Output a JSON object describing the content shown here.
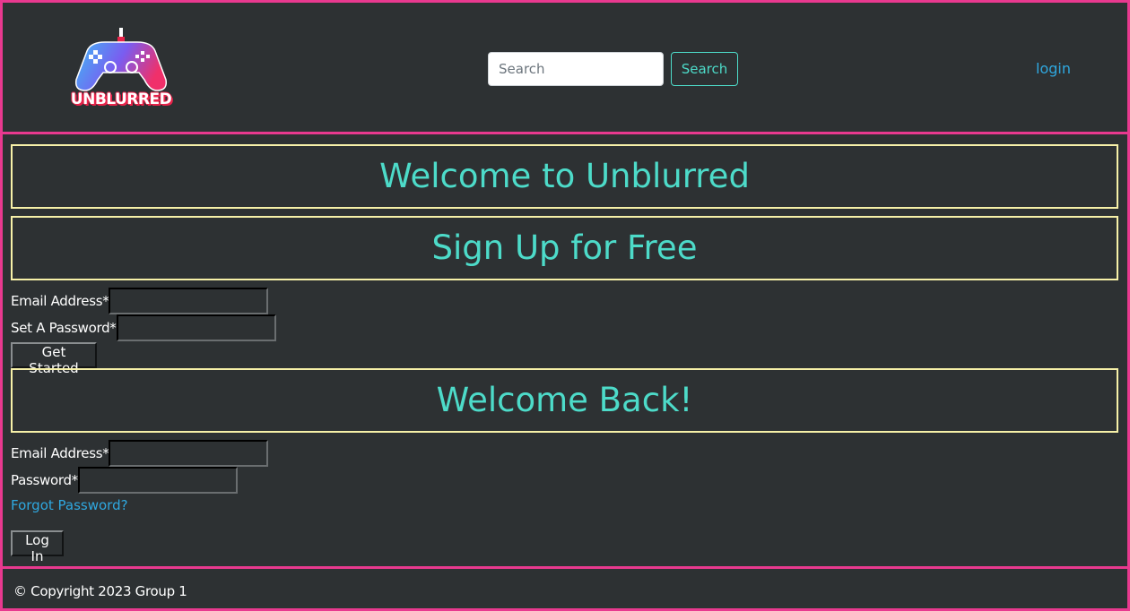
{
  "header": {
    "logo_text": "UNBLURRED",
    "search": {
      "placeholder": "Search",
      "value": "",
      "button_label": "Search"
    },
    "login_label": "login"
  },
  "main": {
    "welcome_title": "Welcome to Unblurred",
    "signup": {
      "title": "Sign Up for Free",
      "email_label": "Email Address*",
      "password_label": "Set A Password*",
      "button_label": "Get Started"
    },
    "login": {
      "title": "Welcome Back!",
      "email_label": "Email Address*",
      "password_label": "Password*",
      "forgot_label": "Forgot Password?",
      "button_label": "Log In"
    }
  },
  "footer": {
    "copyright": "© Copyright 2023 Group 1"
  },
  "colors": {
    "background": "#2d3133",
    "header_border": "#e8398f",
    "banner_border": "#f6f0a8",
    "accent_teal": "#4ddbc9",
    "link_blue": "#2fa8e0"
  },
  "icons": {
    "logo": "gamepad-icon"
  }
}
